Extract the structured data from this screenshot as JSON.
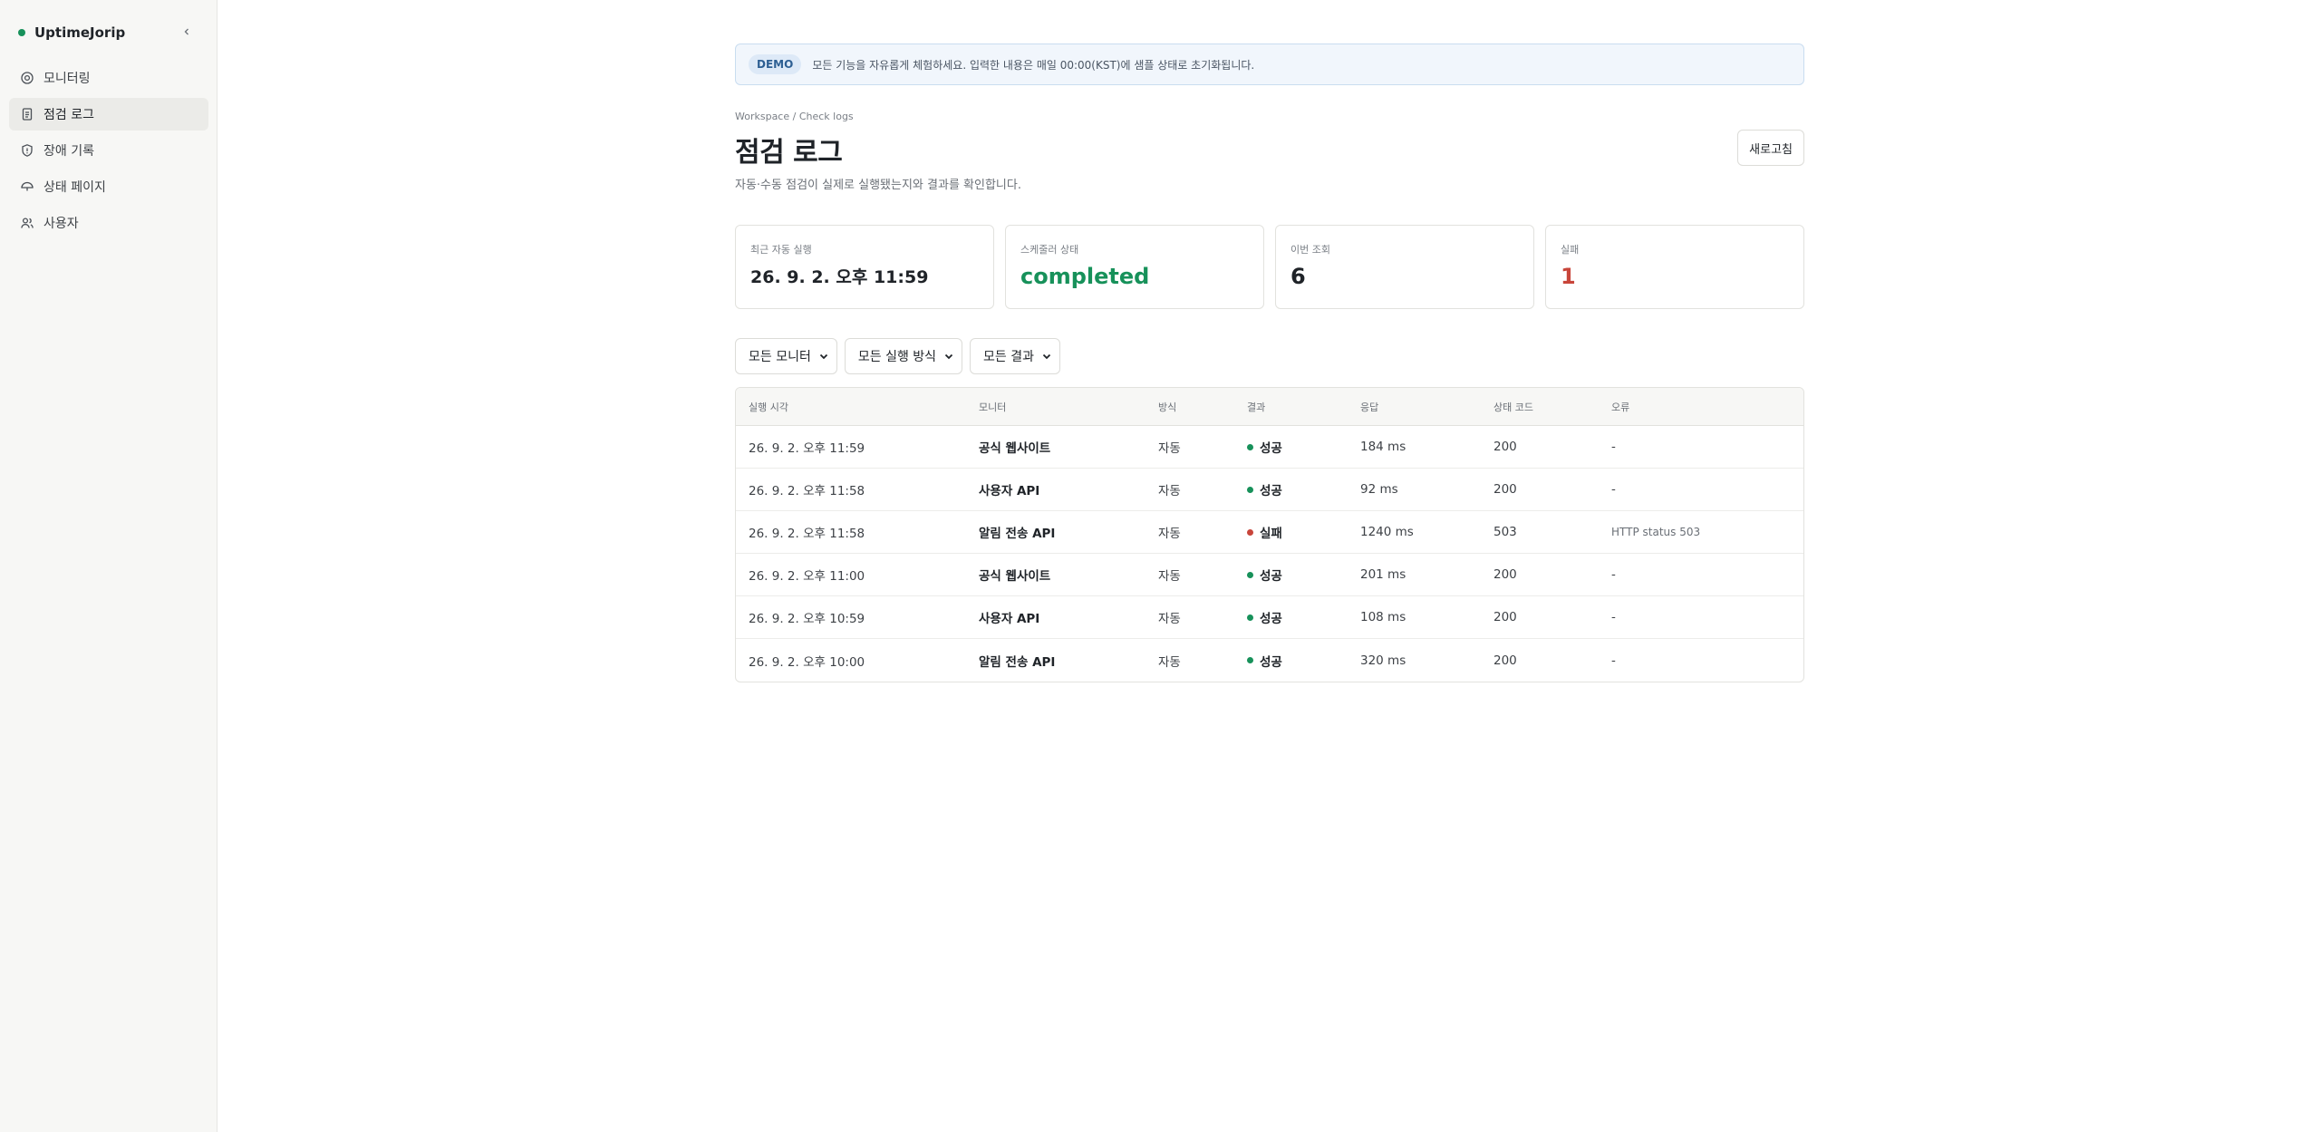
{
  "app": {
    "name": "UptimeJorip"
  },
  "colors": {
    "accent_green": "#17915a",
    "danger_red": "#c8453a",
    "banner_bg": "#f1f6fc"
  },
  "sidebar": {
    "items": [
      {
        "label": "모니터링",
        "icon": "target-icon"
      },
      {
        "label": "점검 로그",
        "icon": "document-icon",
        "active": true
      },
      {
        "label": "장애 기록",
        "icon": "shield-icon"
      },
      {
        "label": "상태 페이지",
        "icon": "umbrella-icon"
      },
      {
        "label": "사용자",
        "icon": "users-icon"
      }
    ]
  },
  "banner": {
    "badge": "DEMO",
    "text": "모든 기능을 자유롭게 체험하세요. 입력한 내용은 매일 00:00(KST)에 샘플 상태로 초기화됩니다."
  },
  "breadcrumb": "Workspace / Check logs",
  "page": {
    "title": "점검 로그",
    "subtitle": "자동·수동 점검이 실제로 실행됐는지와 결과를 확인합니다.",
    "refresh_label": "새로고침"
  },
  "stats": [
    {
      "label": "최근 자동 실행",
      "value": "26. 9. 2. 오후 11:59"
    },
    {
      "label": "스케줄러 상태",
      "value": "completed"
    },
    {
      "label": "이번 조회",
      "value": "6"
    },
    {
      "label": "실패",
      "value": "1"
    }
  ],
  "filters": [
    {
      "selected": "모든 모니터"
    },
    {
      "selected": "모든 실행 방식"
    },
    {
      "selected": "모든 결과"
    }
  ],
  "table": {
    "headers": [
      "실행 시각",
      "모니터",
      "방식",
      "결과",
      "응답",
      "상태 코드",
      "오류"
    ],
    "rows": [
      {
        "time": "26. 9. 2. 오후 11:59",
        "monitor": "공식 웹사이트",
        "mode": "자동",
        "result": "성공",
        "status": "ok",
        "response": "184 ms",
        "code": "200",
        "error": "-"
      },
      {
        "time": "26. 9. 2. 오후 11:58",
        "monitor": "사용자 API",
        "mode": "자동",
        "result": "성공",
        "status": "ok",
        "response": "92 ms",
        "code": "200",
        "error": "-"
      },
      {
        "time": "26. 9. 2. 오후 11:58",
        "monitor": "알림 전송 API",
        "mode": "자동",
        "result": "실패",
        "status": "fail",
        "response": "1240 ms",
        "code": "503",
        "error": "HTTP status 503"
      },
      {
        "time": "26. 9. 2. 오후 11:00",
        "monitor": "공식 웹사이트",
        "mode": "자동",
        "result": "성공",
        "status": "ok",
        "response": "201 ms",
        "code": "200",
        "error": "-"
      },
      {
        "time": "26. 9. 2. 오후 10:59",
        "monitor": "사용자 API",
        "mode": "자동",
        "result": "성공",
        "status": "ok",
        "response": "108 ms",
        "code": "200",
        "error": "-"
      },
      {
        "time": "26. 9. 2. 오후 10:00",
        "monitor": "알림 전송 API",
        "mode": "자동",
        "result": "성공",
        "status": "ok",
        "response": "320 ms",
        "code": "200",
        "error": "-"
      }
    ]
  }
}
